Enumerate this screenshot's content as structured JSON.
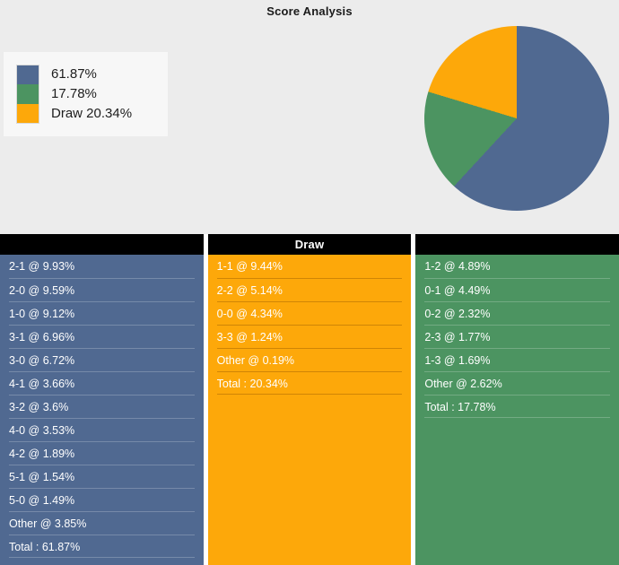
{
  "chart": {
    "title": "Score Analysis",
    "background": "#ececec",
    "legend": [
      {
        "label": "61.87%",
        "color": "#506991",
        "name": "home"
      },
      {
        "label": "17.78%",
        "color": "#4c9461",
        "name": "away"
      },
      {
        "label": "Draw 20.34%",
        "color": "#FDA80A",
        "name": "draw"
      }
    ]
  },
  "chart_data": {
    "type": "pie",
    "title": "Score Analysis",
    "labels": [
      "61.87%",
      "17.78%",
      "Draw 20.34%"
    ],
    "values": [
      61.87,
      17.78,
      20.34
    ],
    "colors": [
      "#506991",
      "#4c9461",
      "#FDA80A"
    ],
    "start_angle_deg": 0,
    "direction": "clockwise",
    "legend_position": "left",
    "xlabel": "",
    "ylabel": ""
  },
  "columns": [
    {
      "key": "home",
      "header": "",
      "color": "#506991",
      "rows": [
        "2-1 @ 9.93%",
        "2-0 @ 9.59%",
        "1-0 @ 9.12%",
        "3-1 @ 6.96%",
        "3-0 @ 6.72%",
        "4-1 @ 3.66%",
        "3-2 @ 3.6%",
        "4-0 @ 3.53%",
        "4-2 @ 1.89%",
        "5-1 @ 1.54%",
        "5-0 @ 1.49%",
        "Other @ 3.85%",
        "Total : 61.87%"
      ]
    },
    {
      "key": "draw",
      "header": "Draw",
      "color": "#FDA80A",
      "rows": [
        "1-1 @ 9.44%",
        "2-2 @ 5.14%",
        "0-0 @ 4.34%",
        "3-3 @ 1.24%",
        "Other @ 0.19%",
        "Total : 20.34%"
      ]
    },
    {
      "key": "away",
      "header": "",
      "color": "#4c9461",
      "rows": [
        "1-2 @ 4.89%",
        "0-1 @ 4.49%",
        "0-2 @ 2.32%",
        "2-3 @ 1.77%",
        "1-3 @ 1.69%",
        "Other @ 2.62%",
        "Total : 17.78%"
      ]
    }
  ]
}
